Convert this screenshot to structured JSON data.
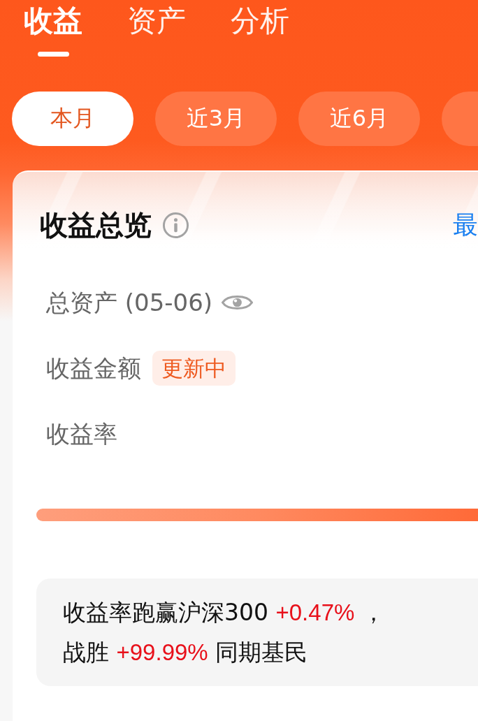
{
  "tabs": [
    {
      "label": "收益",
      "selected": true
    },
    {
      "label": "资产",
      "selected": false
    },
    {
      "label": "分析",
      "selected": false
    }
  ],
  "periods": [
    {
      "label": "本月",
      "selected": true
    },
    {
      "label": "近3月",
      "selected": false
    },
    {
      "label": "近6月",
      "selected": false
    },
    {
      "selected": false
    }
  ],
  "overview": {
    "title": "收益总览",
    "link": "最",
    "rows": [
      {
        "label": "总资产 (05-06)",
        "kind": "visibility"
      },
      {
        "label": "收益金额",
        "kind": "badge",
        "badge": "更新中"
      },
      {
        "label": "收益率",
        "kind": "plain"
      }
    ]
  },
  "summary": {
    "lines": [
      {
        "parts": [
          {
            "text": "收益率跑赢沪深300 ",
            "kind": "plain"
          },
          {
            "text": "+0.47%",
            "kind": "gain"
          },
          {
            "text": " ，",
            "kind": "plain"
          }
        ]
      },
      {
        "parts": [
          {
            "text": "战胜 ",
            "kind": "plain"
          },
          {
            "text": "+99.99%",
            "kind": "gain"
          },
          {
            "text": " 同期基民",
            "kind": "plain"
          }
        ]
      }
    ]
  }
}
